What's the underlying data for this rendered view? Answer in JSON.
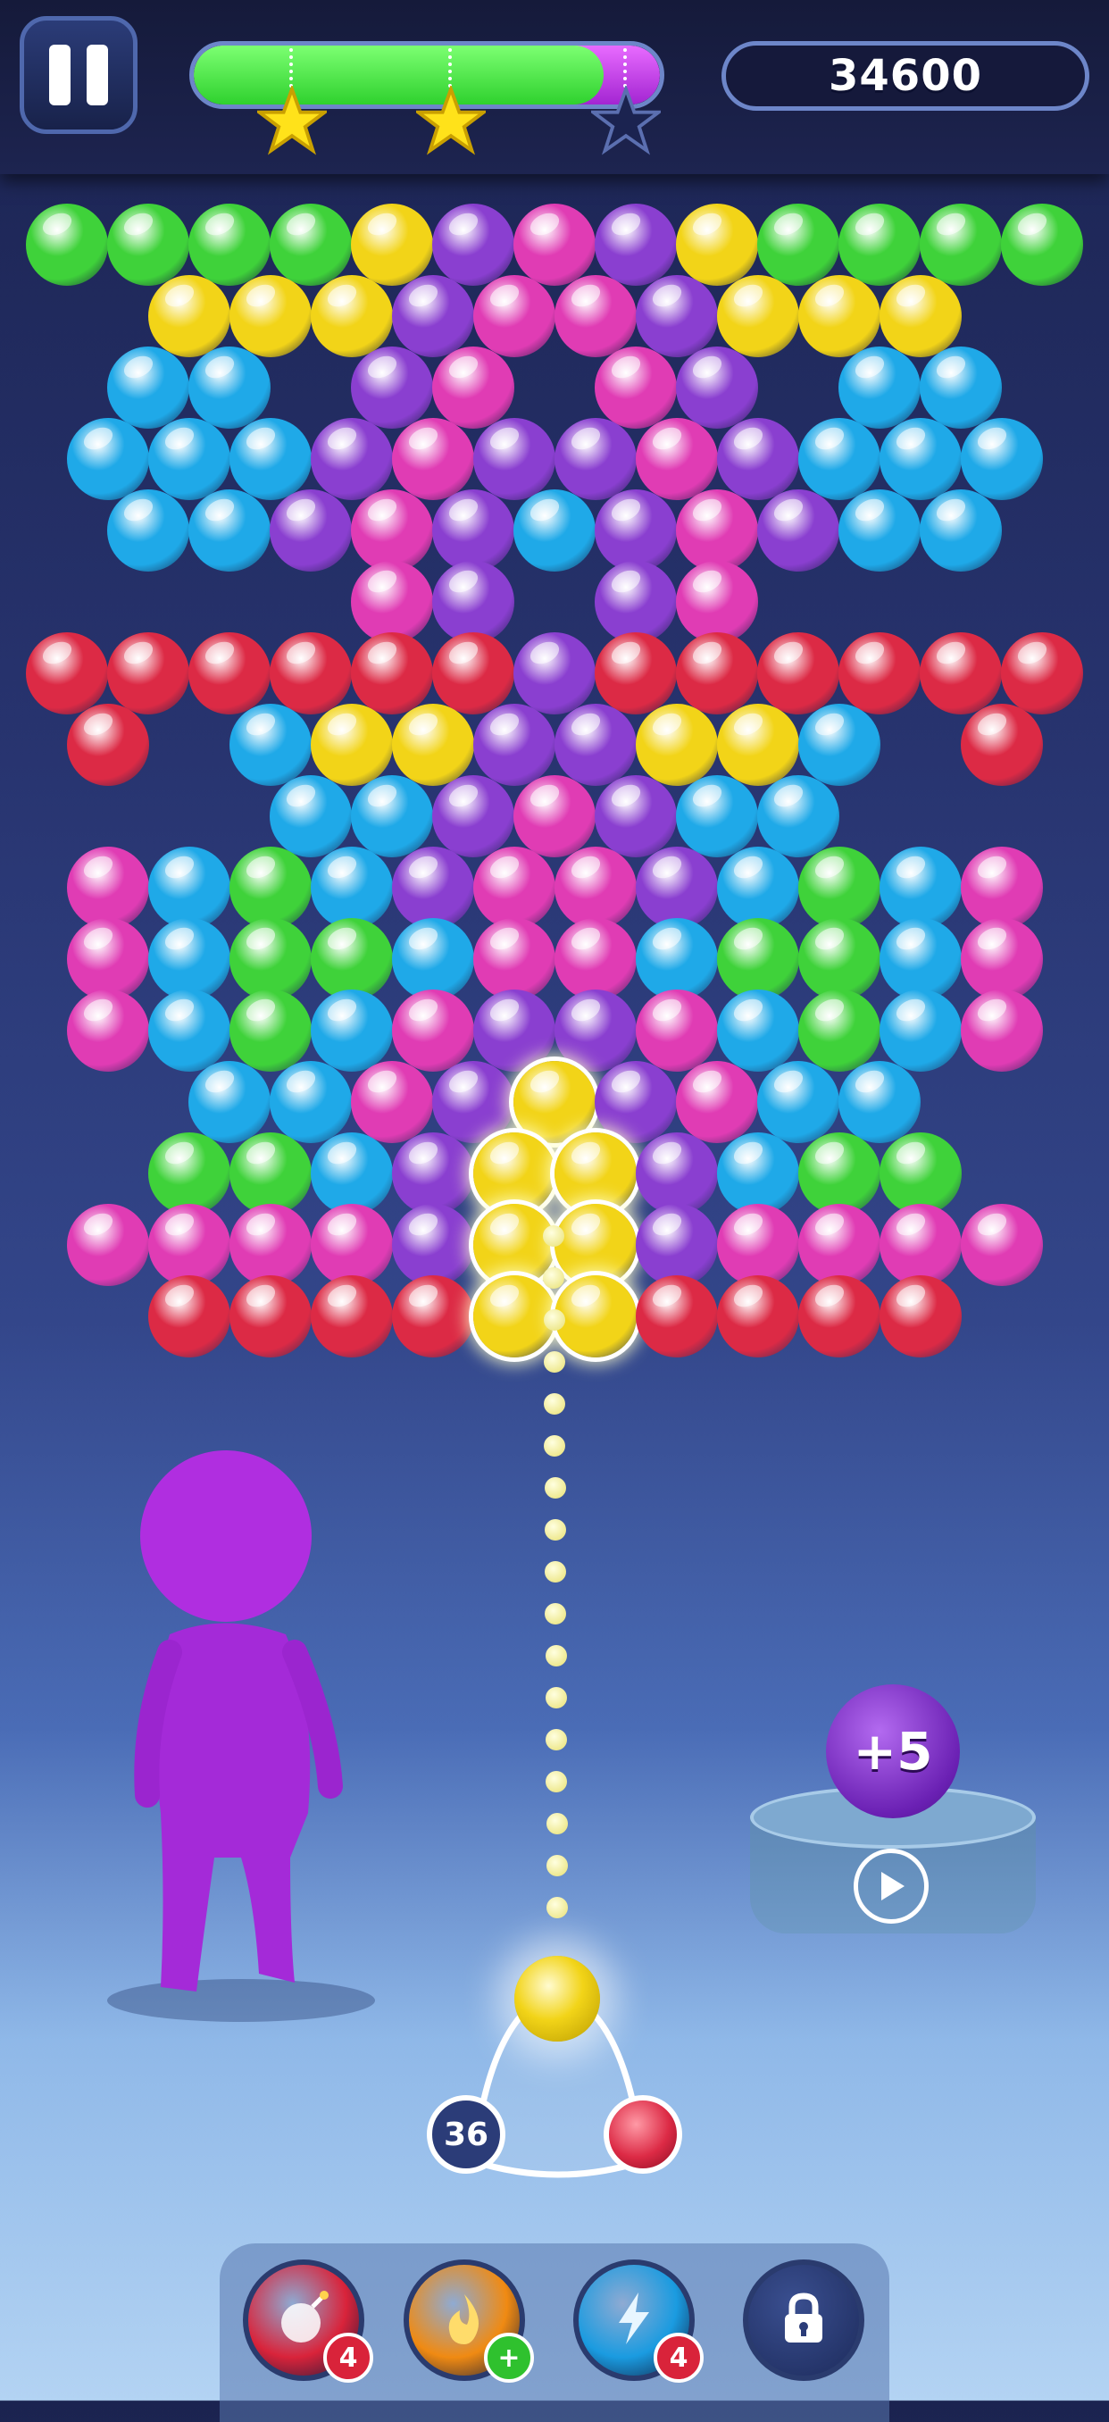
{
  "hud": {
    "score": "34600",
    "progress": 0.88,
    "stars": [
      {
        "earned": true
      },
      {
        "earned": true
      },
      {
        "earned": false
      }
    ]
  },
  "board": {
    "colors": {
      "G": "#3fd23a",
      "Y": "#f2d418",
      "P": "#8a3fd0",
      "M": "#e03cb4",
      "B": "#1fa9e8",
      "R": "#dc2a45"
    },
    "rows": [
      "GGGGYPMPYGGGG",
      "YYYPMMPYYY",
      "BB PM MP BB",
      "BBBPMPPMPBBB",
      "BBPMPBPMPBB",
      "MP PM",
      "RRRRRRPRRRRRR",
      "R BYYPPYYB R",
      "BBPMPBB",
      "MBGBPMMPBGBM",
      "MBGGBMMBGGBM",
      "MBGBMPPMBGBM",
      "BBMPYPMBB",
      "GGBPYYPBGG",
      "MMMMPYYPMMMM",
      "RRRRYYRRRR"
    ]
  },
  "booster": {
    "label": "+5",
    "icon": "play-icon"
  },
  "shooter": {
    "remaining": "36",
    "current_color": "#f2d418",
    "next_color": "#dc2a45"
  },
  "powerups": [
    {
      "name": "bomb",
      "icon": "bomb-icon",
      "count": "4",
      "badge": "count",
      "color": "#d9233a"
    },
    {
      "name": "fire",
      "icon": "fire-icon",
      "count": "+",
      "badge": "plus",
      "color": "#f08a12"
    },
    {
      "name": "lightning",
      "icon": "lightning-icon",
      "count": "4",
      "badge": "count",
      "color": "#1a9be0"
    },
    {
      "name": "locked",
      "icon": "lock-icon",
      "count": "",
      "badge": "none",
      "color": "#2b3c78"
    }
  ]
}
